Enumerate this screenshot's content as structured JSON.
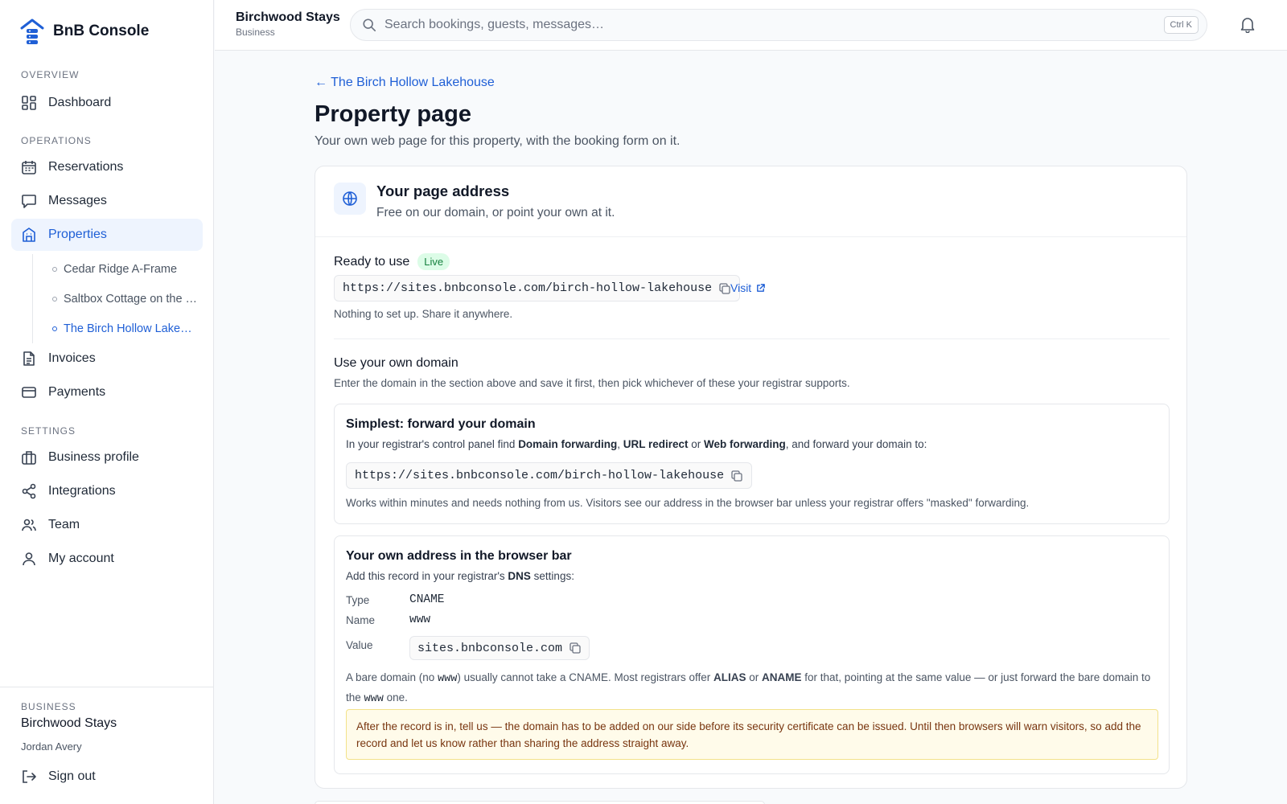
{
  "brand": {
    "name": "BnB Console"
  },
  "sidebar": {
    "sections": {
      "overview": "OVERVIEW",
      "operations": "OPERATIONS",
      "settings": "SETTINGS"
    },
    "items": {
      "dashboard": "Dashboard",
      "reservations": "Reservations",
      "messages": "Messages",
      "properties": "Properties",
      "invoices": "Invoices",
      "payments": "Payments",
      "business_profile": "Business profile",
      "integrations": "Integrations",
      "team": "Team",
      "my_account": "My account"
    },
    "properties_sub": [
      "Cedar Ridge A-Frame",
      "Saltbox Cottage on the …",
      "The Birch Hollow Lake…"
    ],
    "footer": {
      "label": "BUSINESS",
      "business": "Birchwood Stays",
      "user": "Jordan Avery",
      "sign_out": "Sign out"
    }
  },
  "topbar": {
    "title": "Birchwood Stays",
    "subtitle": "Business",
    "search_placeholder": "Search bookings, guests, messages…",
    "shortcut": "Ctrl K"
  },
  "page": {
    "back": "← The Birch Hollow Lakehouse",
    "title": "Property page",
    "lead": "Your own web page for this property, with the booking form on it."
  },
  "card": {
    "title": "Your page address",
    "subtitle": "Free on our domain, or point your own at it.",
    "ready_label": "Ready to use",
    "ready_badge": "Live",
    "url": "https://sites.bnbconsole.com/birch-hollow-lakehouse",
    "visit": "Visit",
    "ready_note": "Nothing to set up. Share it anywhere.",
    "own_title": "Use your own domain",
    "own_sub": "Enter the domain in the section above and save it first, then pick whichever of these your registrar supports.",
    "forward": {
      "title": "Simplest: forward your domain",
      "text_1": "In your registrar's control panel find ",
      "bold_1": "Domain forwarding",
      "text_2": ", ",
      "bold_2": "URL redirect",
      "text_3": " or ",
      "bold_3": "Web forwarding",
      "text_4": ", and forward your domain to:",
      "url": "https://sites.bnbconsole.com/birch-hollow-lakehouse",
      "note": "Works within minutes and needs nothing from us. Visitors see our address in the browser bar unless your registrar offers \"masked\" forwarding."
    },
    "dns": {
      "title": "Your own address in the browser bar",
      "text_1": "Add this record in your registrar's ",
      "bold": "DNS",
      "text_2": " settings:",
      "type_label": "Type",
      "type_value": "CNAME",
      "name_label": "Name",
      "name_value": "www",
      "value_label": "Value",
      "value_value": "sites.bnbconsole.com",
      "bare_1": "A bare domain (no ",
      "bare_www": "www",
      "bare_2": ") usually cannot take a CNAME. Most registrars offer ",
      "bare_alias": "ALIAS",
      "bare_3": " or ",
      "bare_aname": "ANAME",
      "bare_4": " for that, pointing at the same value — or just forward the bare domain to the ",
      "bare_www2": "www",
      "bare_5": " one.",
      "warning": "After the record is in, tell us — the domain has to be added on our side before its security certificate can be issued. Until then browsers will warn visitors, so add the record and let us know rather than sharing the address straight away."
    }
  },
  "colors": {
    "accent": "#1f5fd6",
    "active_bg": "#eef4fe",
    "live_badge": "#15803d",
    "warning_bg": "#fffbea"
  }
}
